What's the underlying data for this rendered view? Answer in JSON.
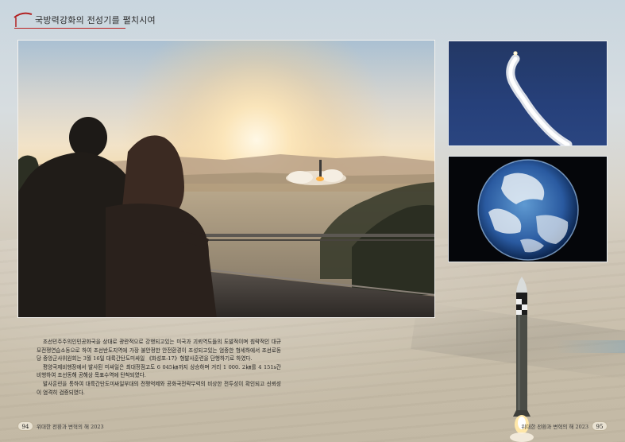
{
  "header": {
    "title": "국방력강화의 전성기를 펼치시여"
  },
  "body": {
    "paragraphs": [
      "조선민주주의인민공화국을 상대로 광란적으로 강행되고있는 미국과 괴뢰역도들의 도발적이며 침략적인 대규모전쟁연습소동으로 하여 조선반도지역에 가장 불안정한 안전환경이 조성되고있는 엄중한 형세하에서 조선로동당 중앙군사위원회는 3월 16일 대륙간탄도미싸일 《화성포-17》형발사훈련을 단행하기로 하였다.",
      "평양국제비행장에서 발사된 미싸일은 최대정점고도 6 045㎞까지 상승하며 거리 1 000. 2㎞를 4 151s간 비행하여 조선동해 공해상 목표수역에 탄착되였다.",
      "발사훈련을 통하여 대륙간탄도미싸일부대의 전쟁억제와 공화국전략무력의 비상한 전투성이 확인되고 신뢰성이 엄격히 검증되였다."
    ]
  },
  "footer": {
    "left_page": "94",
    "left_text": "위대한 전환과 변혁의 해 2023",
    "right_text": "위대한 전환과 변혁의 해 2023",
    "right_page": "95"
  },
  "photos": {
    "main": "silhouettes-watching-missile-launch-at-sunrise",
    "top_right": "missile-ascending-with-smoke-trail",
    "bottom_right": "earth-from-space",
    "bottom_standing": "icbm-on-launch"
  },
  "colors": {
    "header_accent": "#b22222",
    "text": "#1e1e1e"
  }
}
